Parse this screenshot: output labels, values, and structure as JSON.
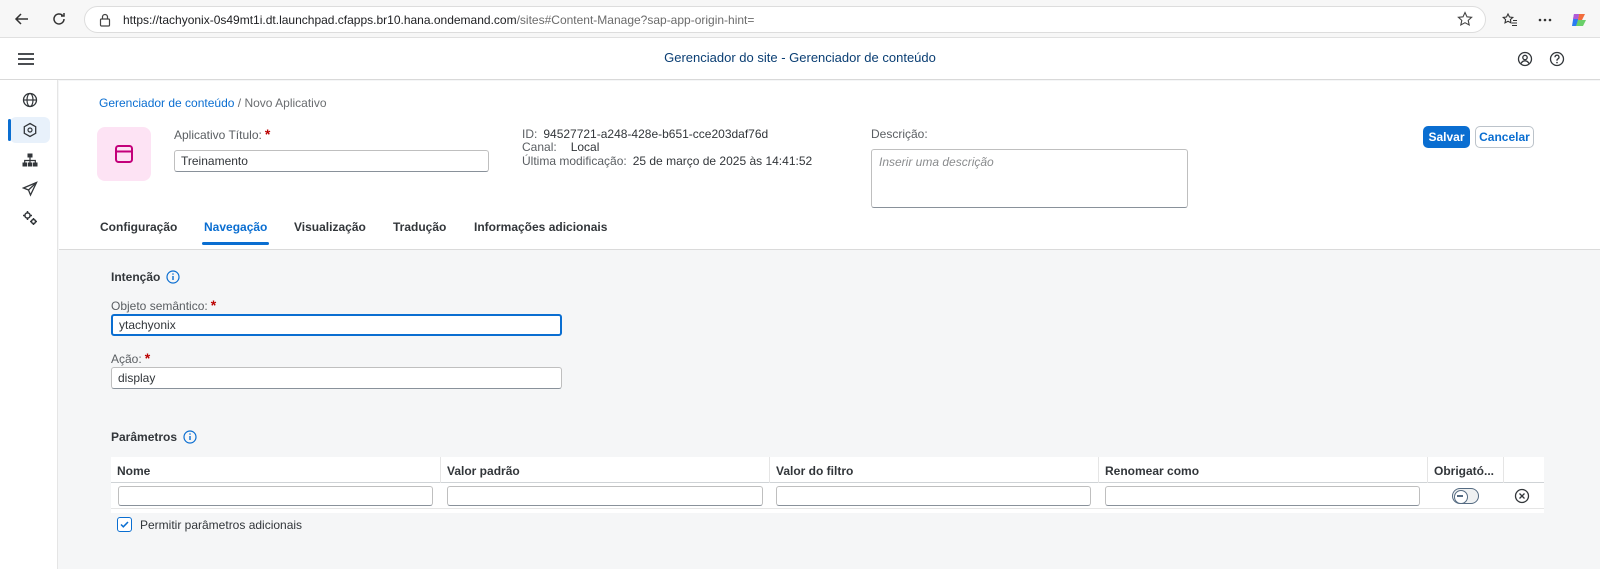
{
  "browser": {
    "url_host": "https://tachyonix-0s49mt1i.dt.launchpad.cfapps.br10.hana.ondemand.com",
    "url_path": "/sites#Content-Manage?sap-app-origin-hint="
  },
  "shell": {
    "title": "Gerenciador do site - Gerenciador de conteúdo"
  },
  "breadcrumb": {
    "link": "Gerenciador de conteúdo",
    "separator": "/",
    "current": "Novo Aplicativo"
  },
  "header": {
    "title_label": "Aplicativo Título:",
    "title_value": "Treinamento",
    "id_label": "ID:",
    "id_value": "94527721-a248-428e-b651-cce203daf76d",
    "channel_label": "Canal:",
    "channel_value": "Local",
    "modified_label": "Última modificação:",
    "modified_value": "25 de março de 2025 às 14:41:52",
    "description_label": "Descrição:",
    "description_placeholder": "Inserir uma descrição",
    "save_label": "Salvar",
    "cancel_label": "Cancelar",
    "required_mark": "*"
  },
  "tabs": [
    {
      "label": "Configuração"
    },
    {
      "label": "Navegação"
    },
    {
      "label": "Visualização"
    },
    {
      "label": "Tradução"
    },
    {
      "label": "Informações adicionais"
    }
  ],
  "active_tab": "Navegação",
  "intent": {
    "title": "Intenção",
    "semantic_label": "Objeto semântico:",
    "semantic_value": "ytachyonix",
    "action_label": "Ação:",
    "action_value": "display"
  },
  "params": {
    "title": "Parâmetros",
    "columns": [
      "Nome",
      "Valor padrão",
      "Valor do filtro",
      "Renomear como",
      "Obrigató..."
    ],
    "allow_extra_label": "Permitir parâmetros adicionais",
    "allow_extra_checked": true
  },
  "colors": {
    "accent": "#0a6ed1",
    "title_blue": "#0a3e73",
    "tile_bg": "#fde3f4",
    "tile_icon": "#c3007a",
    "required": "#bb0000"
  }
}
